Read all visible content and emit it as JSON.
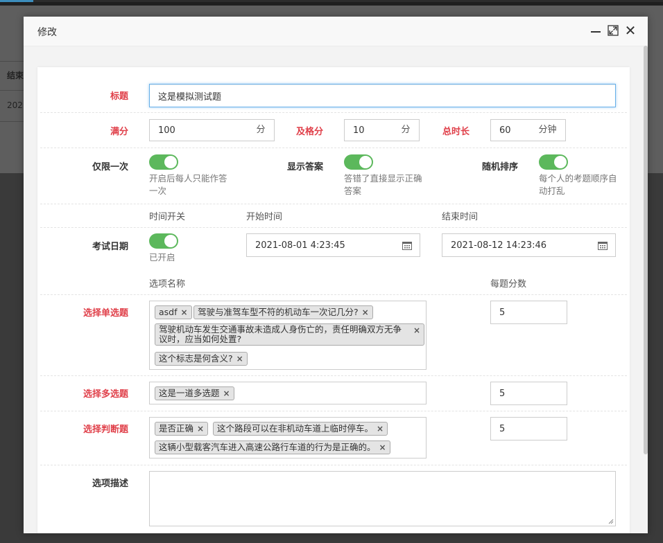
{
  "background": {
    "col_header": "结束",
    "cell_value": "202"
  },
  "modal": {
    "title": "修改",
    "header_icons": [
      "minimize-icon",
      "maximize-icon",
      "close-icon"
    ]
  },
  "form": {
    "title_field": {
      "label": "标题",
      "value": "这是模拟测试题"
    },
    "full_score": {
      "label": "满分",
      "value": "100",
      "unit": "分"
    },
    "pass_score": {
      "label": "及格分",
      "value": "10",
      "unit": "分"
    },
    "duration": {
      "label": "总时长",
      "value": "60",
      "unit": "分钟"
    },
    "once_only": {
      "label": "仅限一次",
      "enabled": true,
      "hint": "开启后每人只能作答一次"
    },
    "show_answer": {
      "label": "显示答案",
      "enabled": true,
      "hint": "答错了直接显示正确答案"
    },
    "random_order": {
      "label": "随机排序",
      "enabled": true,
      "hint": "每个人的考题顺序自动打乱"
    },
    "exam_date": {
      "label": "考试日期",
      "switch_header": "时间开关",
      "start_header": "开始时间",
      "end_header": "结束时间",
      "enabled": true,
      "status": "已开启",
      "start_value": "2021-08-01 4:23:45",
      "end_value": "2021-08-12 14:23:46"
    },
    "option_name_header": "选项名称",
    "score_per_question_header": "每题分数",
    "single_choice": {
      "label": "选择单选题",
      "tags": [
        "asdf",
        "驾驶与准驾车型不符的机动车一次记几分?",
        "驾驶机动车发生交通事故未造成人身伤亡的，责任明确双方无争议时，应当如何处置?",
        "这个标志是何含义?"
      ],
      "score": "5"
    },
    "multi_choice": {
      "label": "选择多选题",
      "tags": [
        "这是一道多选题"
      ],
      "score": "5"
    },
    "judge": {
      "label": "选择判断题",
      "tags": [
        "是否正确",
        "这个路段可以在非机动车道上临时停车。",
        "这辆小型载客汽车进入高速公路行车道的行为是正确的。"
      ],
      "score": "5"
    },
    "description": {
      "label": "选项描述",
      "value": ""
    }
  },
  "colors": {
    "required_label": "#e0404a",
    "toggle_on": "#5cb85c",
    "focus_border": "#66afe9"
  }
}
